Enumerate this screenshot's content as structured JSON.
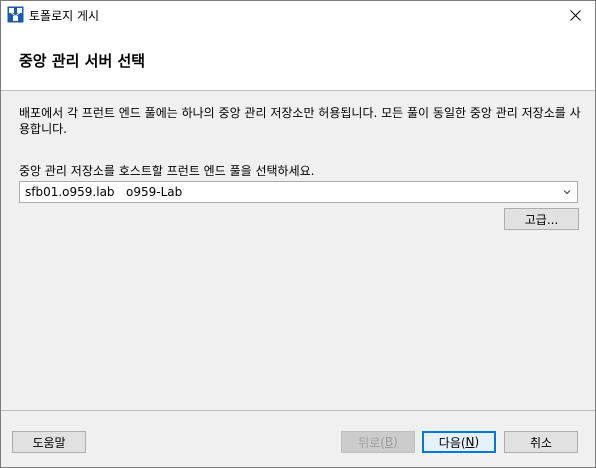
{
  "window": {
    "title": "토폴로지 게시",
    "close_glyph": "✕"
  },
  "header": {
    "title": "중앙 관리 서버 선택"
  },
  "content": {
    "description": "배포에서 각 프런트 엔드 풀에는 하나의 중앙 관리 저장소만 허용됩니다. 모든 풀이 동일한 중앙 관리 저장소를 사용합니다.",
    "select_label": "중앙 관리 저장소를 호스트할 프런트 엔드 풀을 선택하세요.",
    "select_value": "sfb01.o959.lab   o959-Lab",
    "advanced_button": "고급..."
  },
  "footer": {
    "help_button": "도움말",
    "back_button_prefix": "뒤로(",
    "back_button_key": "B",
    "next_button_prefix": "다음(",
    "next_button_key": "N",
    "button_suffix": ")",
    "cancel_button": "취소"
  },
  "colors": {
    "primary_border": "#0078d7",
    "window_bg": "#f0f0f0",
    "header_bg": "#ffffff"
  }
}
